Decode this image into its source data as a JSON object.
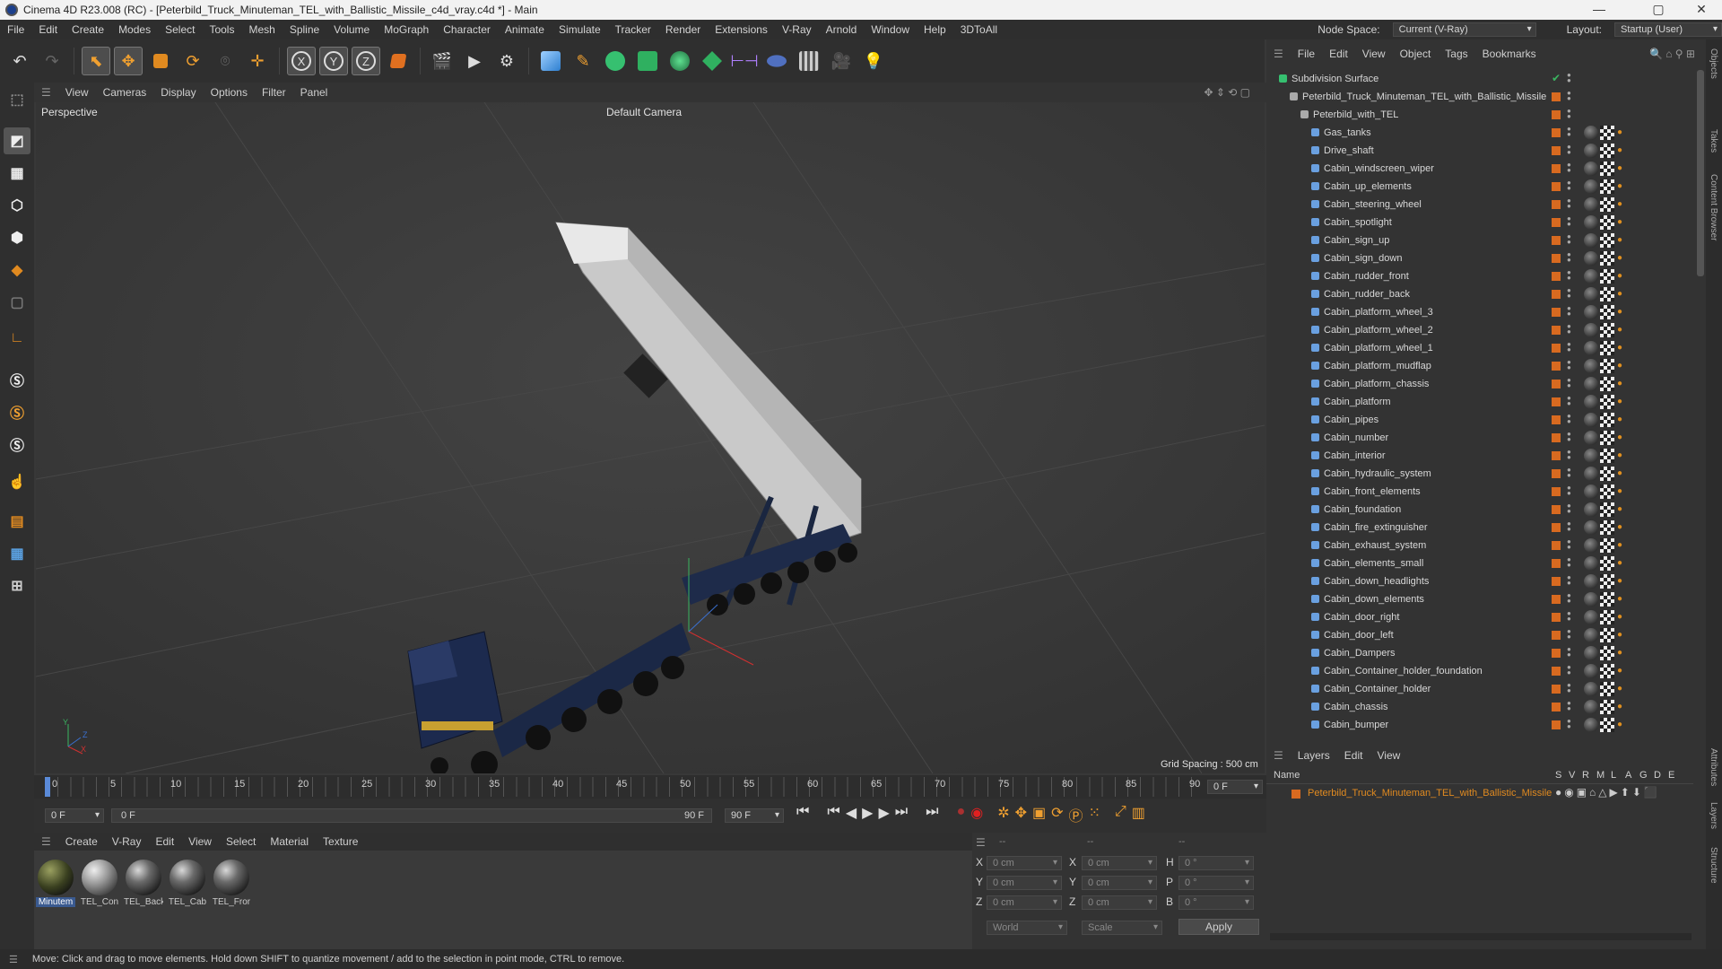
{
  "window": {
    "title": "Cinema 4D R23.008 (RC) - [Peterbild_Truck_Minuteman_TEL_with_Ballistic_Missile_c4d_vray.c4d *] - Main",
    "min": "—",
    "max": "▢",
    "close": "✕"
  },
  "menubar": {
    "items": [
      "File",
      "Edit",
      "Create",
      "Modes",
      "Select",
      "Tools",
      "Mesh",
      "Spline",
      "Volume",
      "MoGraph",
      "Character",
      "Animate",
      "Simulate",
      "Tracker",
      "Render",
      "Extensions",
      "V-Ray",
      "Arnold",
      "Window",
      "Help",
      "3DToAll"
    ],
    "node_space_label": "Node Space:",
    "node_space_value": "Current (V-Ray)",
    "layout_label": "Layout:",
    "layout_value": "Startup (User)"
  },
  "toolbar": {
    "x": "X",
    "y": "Y",
    "z": "Z"
  },
  "viewport": {
    "menu": [
      "View",
      "Cameras",
      "Display",
      "Options",
      "Filter",
      "Panel"
    ],
    "view_name": "Perspective",
    "camera": "Default Camera",
    "grid_spacing": "Grid Spacing : 500 cm",
    "axis_y": "Y",
    "axis_z": "Z",
    "axis_x": "X"
  },
  "timeline": {
    "ticks": [
      "0",
      "5",
      "10",
      "15",
      "20",
      "25",
      "30",
      "35",
      "40",
      "45",
      "50",
      "55",
      "60",
      "65",
      "70",
      "75",
      "80",
      "85",
      "90"
    ],
    "frame_end_field": "0 F"
  },
  "transport": {
    "current": "0 F",
    "range_start": "0 F",
    "range_end": "90 F",
    "max": "90 F"
  },
  "materials": {
    "menu": [
      "Create",
      "V-Ray",
      "Edit",
      "View",
      "Select",
      "Material",
      "Texture"
    ],
    "items": [
      "Minutem",
      "TEL_Con",
      "TEL_Back",
      "TEL_Cab",
      "TEL_Fror"
    ]
  },
  "coords": {
    "header": [
      "--",
      "--",
      "--"
    ],
    "rows": [
      {
        "a": "X",
        "av": "0 cm",
        "b": "X",
        "bv": "0 cm",
        "c": "H",
        "cv": "0 °"
      },
      {
        "a": "Y",
        "av": "0 cm",
        "b": "Y",
        "bv": "0 cm",
        "c": "P",
        "cv": "0 °"
      },
      {
        "a": "Z",
        "av": "0 cm",
        "b": "Z",
        "bv": "0 cm",
        "c": "B",
        "cv": "0 °"
      }
    ],
    "world": "World",
    "scale": "Scale",
    "apply": "Apply"
  },
  "object_manager": {
    "menu": [
      "File",
      "Edit",
      "View",
      "Object",
      "Tags",
      "Bookmarks"
    ],
    "root": "Subdivision Surface",
    "parent": "Peterbild_Truck_Minuteman_TEL_with_Ballistic_Missile",
    "group": "Peterbild_with_TEL",
    "objects": [
      "Gas_tanks",
      "Drive_shaft",
      "Cabin_windscreen_wiper",
      "Cabin_up_elements",
      "Cabin_steering_wheel",
      "Cabin_spotlight",
      "Cabin_sign_up",
      "Cabin_sign_down",
      "Cabin_rudder_front",
      "Cabin_rudder_back",
      "Cabin_platform_wheel_3",
      "Cabin_platform_wheel_2",
      "Cabin_platform_wheel_1",
      "Cabin_platform_mudflap",
      "Cabin_platform_chassis",
      "Cabin_platform",
      "Cabin_pipes",
      "Cabin_number",
      "Cabin_interior",
      "Cabin_hydraulic_system",
      "Cabin_front_elements",
      "Cabin_foundation",
      "Cabin_fire_extinguisher",
      "Cabin_exhaust_system",
      "Cabin_elements_small",
      "Cabin_down_headlights",
      "Cabin_down_elements",
      "Cabin_door_right",
      "Cabin_door_left",
      "Cabin_Dampers",
      "Cabin_Container_holder_foundation",
      "Cabin_Container_holder",
      "Cabin_chassis",
      "Cabin_bumper"
    ]
  },
  "layers": {
    "menu": [
      "Layers",
      "Edit",
      "View"
    ],
    "name_col": "Name",
    "cols": [
      "S",
      "V",
      "R",
      "M",
      "L",
      "A",
      "G",
      "D",
      "E"
    ],
    "layer": "Peterbild_Truck_Minuteman_TEL_with_Ballistic_Missile"
  },
  "right_tabs": [
    "Objects",
    "Takes",
    "Content Browser",
    "Attributes",
    "Layers",
    "Structure"
  ],
  "status": "Move: Click and drag to move elements. Hold down SHIFT to quantize movement / add to the selection in point mode, CTRL to remove."
}
